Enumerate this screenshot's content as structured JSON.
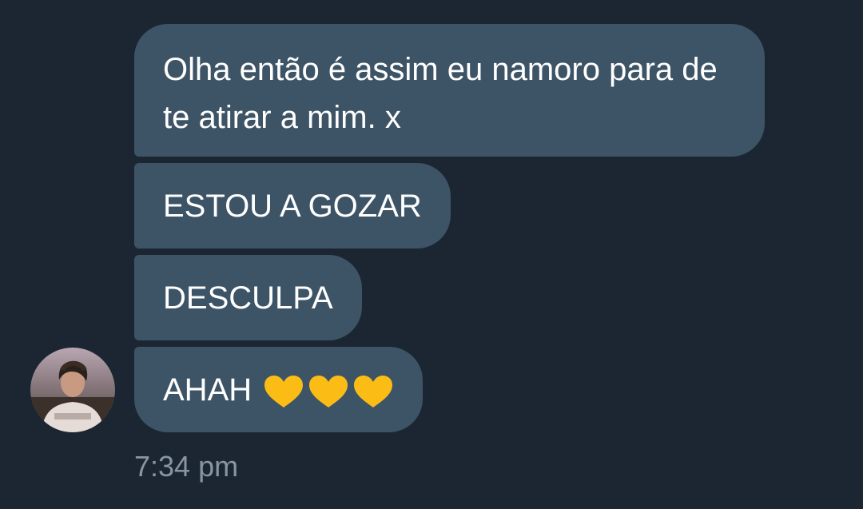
{
  "messages": [
    {
      "text": "Olha então é assim eu namoro para de te atirar a mim. x"
    },
    {
      "text": "ESTOU A GOZAR"
    },
    {
      "text": "DESCULPA"
    },
    {
      "text": "AHAH",
      "emoji": [
        "yellow-heart",
        "yellow-heart",
        "yellow-heart"
      ]
    }
  ],
  "timestamp": "7:34 pm",
  "avatar": {
    "icon": "profile-photo"
  },
  "colors": {
    "background": "#1c2632",
    "bubble": "#3d5466",
    "text": "#ffffff",
    "timestamp": "#8796a3",
    "heart": "#fbbd15"
  }
}
